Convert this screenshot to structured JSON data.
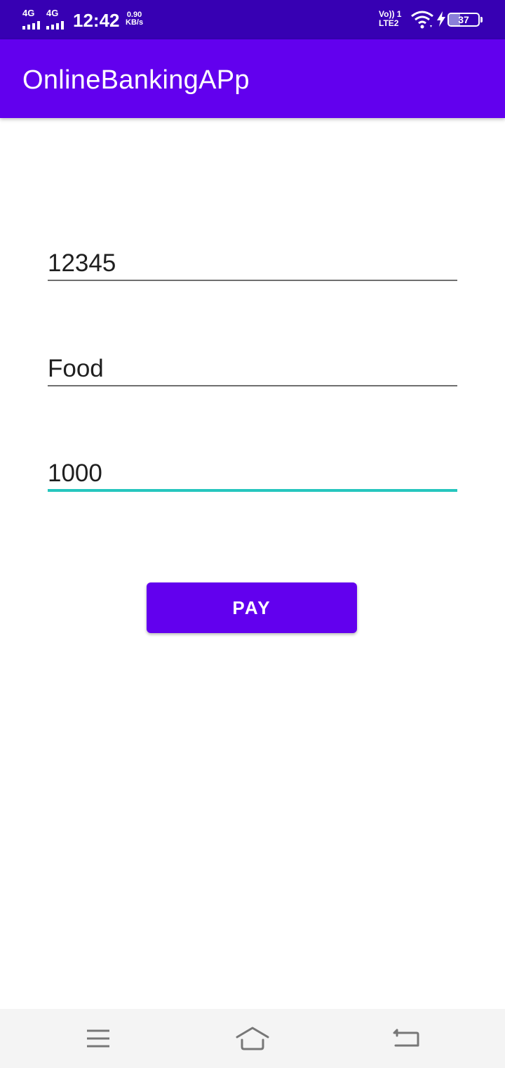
{
  "status_bar": {
    "network1": "4G",
    "network2": "4G",
    "time": "12:42",
    "speed_value": "0.90",
    "speed_unit": "KB/s",
    "volte_line1": "Vo)) 1",
    "volte_line2": "LTE2",
    "battery_level": "37",
    "battery_fraction": 0.37
  },
  "app_bar": {
    "title": "OnlineBankingAPp"
  },
  "form": {
    "field1_value": "12345",
    "field2_value": "Food",
    "field3_value": "1000",
    "focused_field": "field3"
  },
  "pay_button": {
    "label": "PAY"
  },
  "nav_bar": {
    "icons": [
      "menu-icon",
      "home-icon",
      "back-icon"
    ]
  },
  "colors": {
    "status_bar": "#3700b3",
    "primary": "#6200ee",
    "accent": "#26c6be",
    "nav_bar": "#f4f4f4"
  }
}
